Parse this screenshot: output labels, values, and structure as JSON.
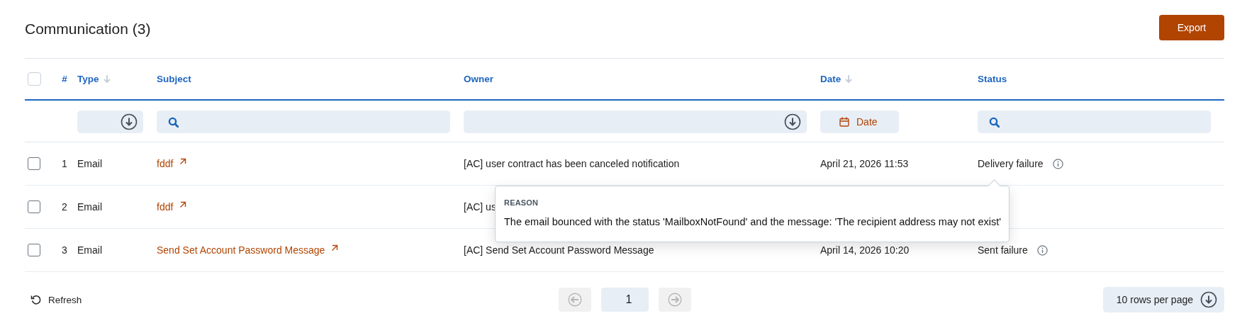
{
  "header": {
    "title": "Communication (3)",
    "export_button": "Export"
  },
  "table": {
    "select_all": {
      "checked": false
    },
    "columns": [
      {
        "label": "#",
        "sortable": false
      },
      {
        "label": "Type",
        "sortable": true
      },
      {
        "label": "Subject",
        "sortable": false
      },
      {
        "label": "Owner",
        "sortable": false
      },
      {
        "label": "Date",
        "sortable": true
      },
      {
        "label": "Status",
        "sortable": false
      }
    ],
    "filters": [
      {
        "kind": "dropdown"
      },
      {
        "kind": "search"
      },
      {
        "kind": "dropdown"
      },
      {
        "kind": "date",
        "label": "Date"
      },
      {
        "kind": "search"
      }
    ],
    "rows": [
      {
        "checked": false,
        "index": "1",
        "type": "Email",
        "subject": "fddf",
        "owner": "[AC] user contract has been canceled notification",
        "date": "April 21, 2026 11:53",
        "status": "Delivery failure",
        "info": true
      },
      {
        "checked": false,
        "index": "2",
        "type": "Email",
        "subject": "fddf",
        "owner": "[AC] us"
      },
      {
        "checked": false,
        "index": "3",
        "type": "Email",
        "subject": "Send Set Account Password Message",
        "owner": "[AC] Send Set Account Password Message",
        "date": "April 14, 2026 10:20",
        "status": "Sent failure",
        "info": true
      }
    ]
  },
  "tooltip": {
    "heading": "REASON",
    "text": "The email bounced with the status 'MailboxNotFound' and the message: 'The recipient address may not exist'"
  },
  "footer": {
    "refresh": "Refresh",
    "pagination": {
      "prev_disabled": true,
      "pages": [
        {
          "label": "1",
          "selected": true
        }
      ],
      "next_disabled": true
    },
    "rows_per_page": "10 rows per page"
  }
}
